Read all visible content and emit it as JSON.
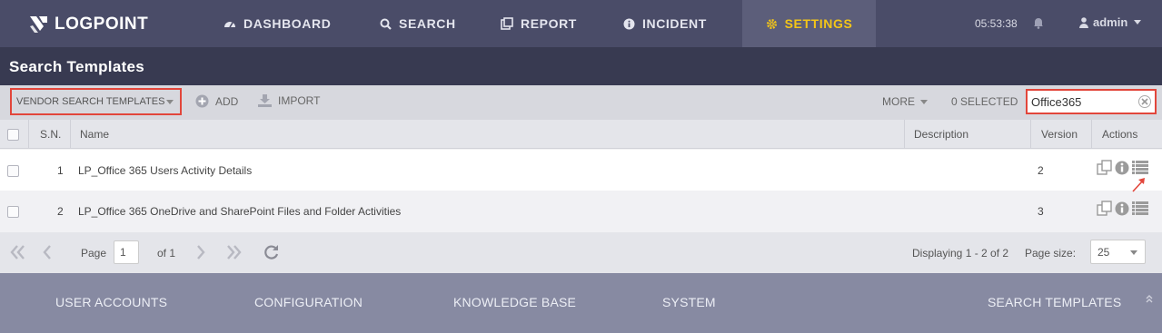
{
  "brand": {
    "name": "LOGPOINT"
  },
  "nav": {
    "items": [
      {
        "label": "DASHBOARD",
        "icon": "dashboard-icon"
      },
      {
        "label": "SEARCH",
        "icon": "search-icon"
      },
      {
        "label": "REPORT",
        "icon": "report-icon"
      },
      {
        "label": "INCIDENT",
        "icon": "info-icon"
      },
      {
        "label": "SETTINGS",
        "icon": "gear-icon",
        "active": true
      }
    ],
    "clock": "05:53:38",
    "user": "admin"
  },
  "page": {
    "title": "Search Templates"
  },
  "toolbar": {
    "vendor_dropdown": "VENDOR SEARCH TEMPLATES",
    "add_label": "ADD",
    "import_label": "IMPORT",
    "more_label": "MORE",
    "selected_label": "0 SELECTED",
    "search_value": "Office365"
  },
  "grid": {
    "columns": {
      "sn": "S.N.",
      "name": "Name",
      "description": "Description",
      "version": "Version",
      "actions": "Actions"
    },
    "rows": [
      {
        "sn": "1",
        "name": "LP_Office 365 Users Activity Details",
        "description": "",
        "version": "2"
      },
      {
        "sn": "2",
        "name": "LP_Office 365 OneDrive and SharePoint Files and Folder Activities",
        "description": "",
        "version": "3"
      }
    ]
  },
  "pager": {
    "page_label": "Page",
    "page_value": "1",
    "of_label": "of 1",
    "displaying": "Displaying 1 - 2 of 2",
    "page_size_label": "Page size:",
    "page_size_value": "25"
  },
  "footer": {
    "items": [
      "USER ACCOUNTS",
      "CONFIGURATION",
      "KNOWLEDGE BASE",
      "SYSTEM",
      "SEARCH TEMPLATES"
    ]
  },
  "colors": {
    "nav_bg": "#4a4c68",
    "title_bg": "#383a51",
    "active_accent": "#f3c518",
    "highlight_border": "#e2463b",
    "footer_bg": "#878aa2"
  }
}
